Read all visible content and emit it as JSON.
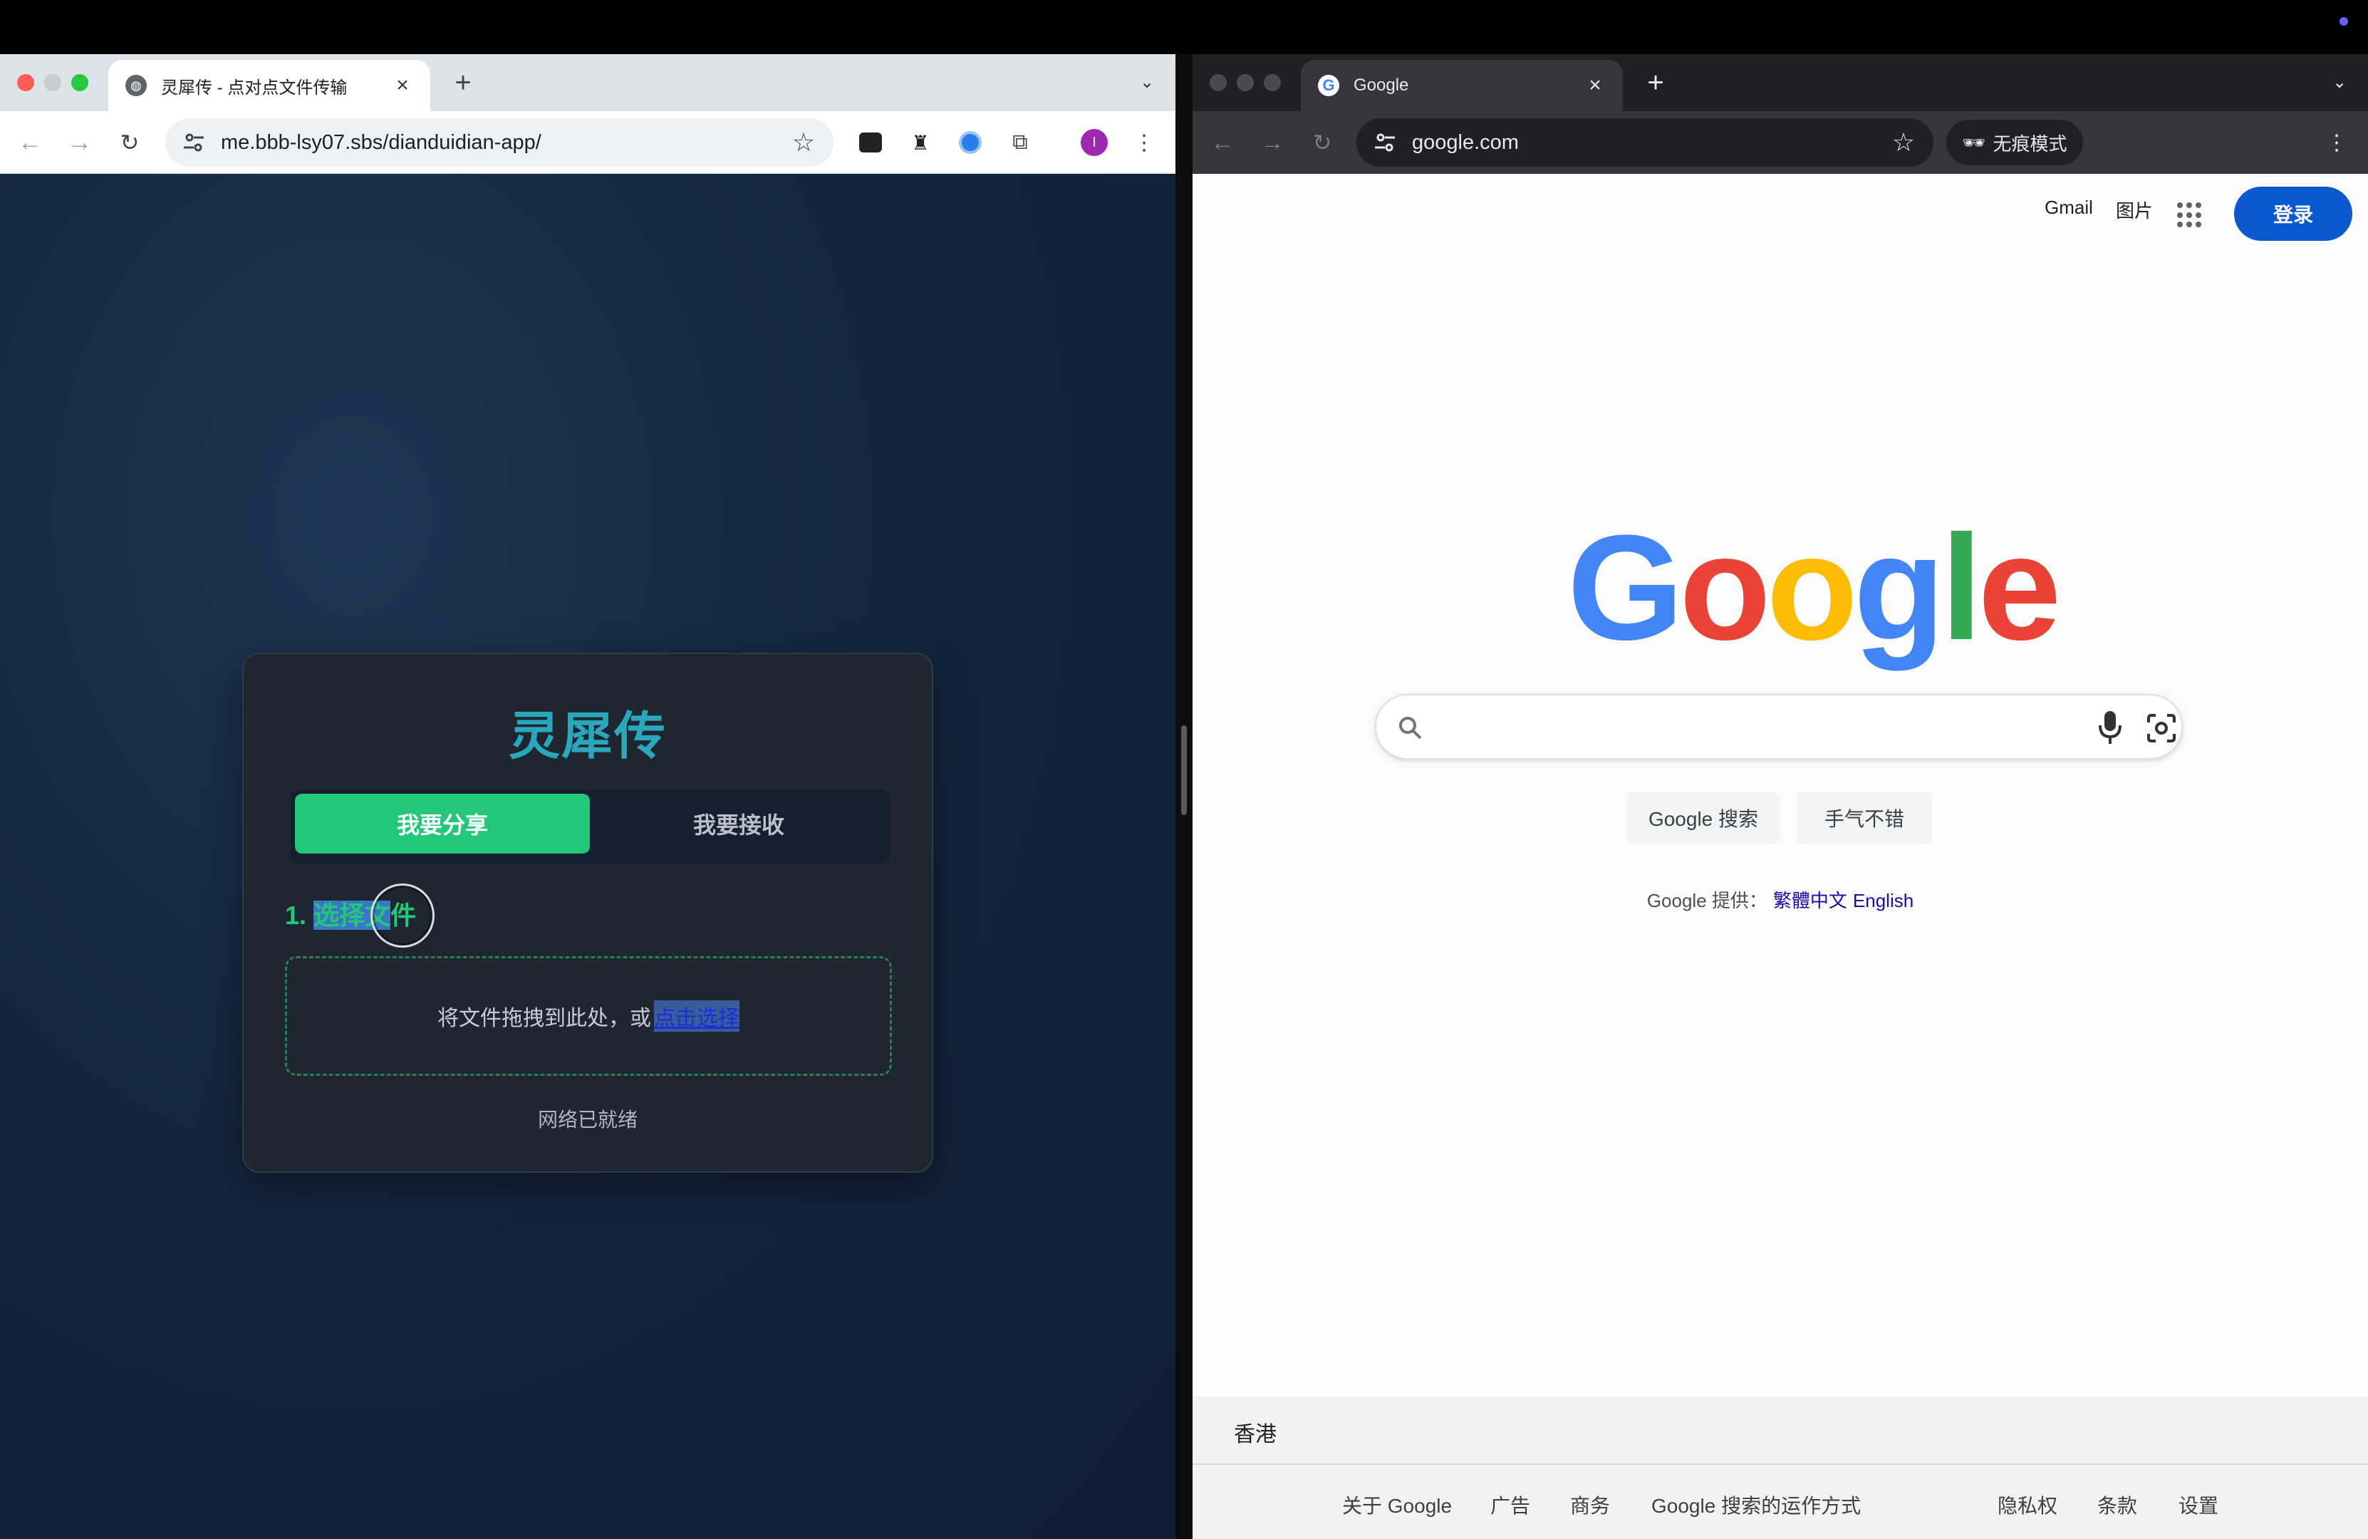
{
  "left_browser": {
    "tab_title": "灵犀传 - 点对点文件传输",
    "url": "me.bbb-lsy07.sbs/dianduidian-app/",
    "profile_initial": "I"
  },
  "right_browser": {
    "tab_title": "Google",
    "url": "google.com",
    "incognito_label": "无痕模式"
  },
  "app": {
    "title": "灵犀传",
    "tab_share": "我要分享",
    "tab_receive": "我要接收",
    "step_number": "1. ",
    "step_selected": "选择文",
    "step_rest": "件",
    "drop_text": "将文件拖拽到此处，或",
    "drop_link": "点击选择",
    "status": "网络已就绪"
  },
  "google": {
    "gmail": "Gmail",
    "images": "图片",
    "signin": "登录",
    "logo_letters": [
      "G",
      "o",
      "o",
      "g",
      "l",
      "e"
    ],
    "logo_colors": [
      "#4285F4",
      "#EA4335",
      "#FBBC05",
      "#4285F4",
      "#34A853",
      "#EA4335"
    ],
    "search_button": "Google 搜索",
    "lucky_button": "手气不错",
    "offered_prefix": "Google 提供：",
    "lang_trad": "繁體中文",
    "lang_en": "English",
    "region": "香港",
    "footer_left": [
      "关于 Google",
      "广告",
      "商务",
      "Google 搜索的运作方式"
    ],
    "footer_right": [
      "隐私权",
      "条款",
      "设置"
    ]
  },
  "colors": {
    "accent_green": "#22c77a",
    "title_teal": "#2aa6bd",
    "google_blue": "#0b57d0"
  }
}
